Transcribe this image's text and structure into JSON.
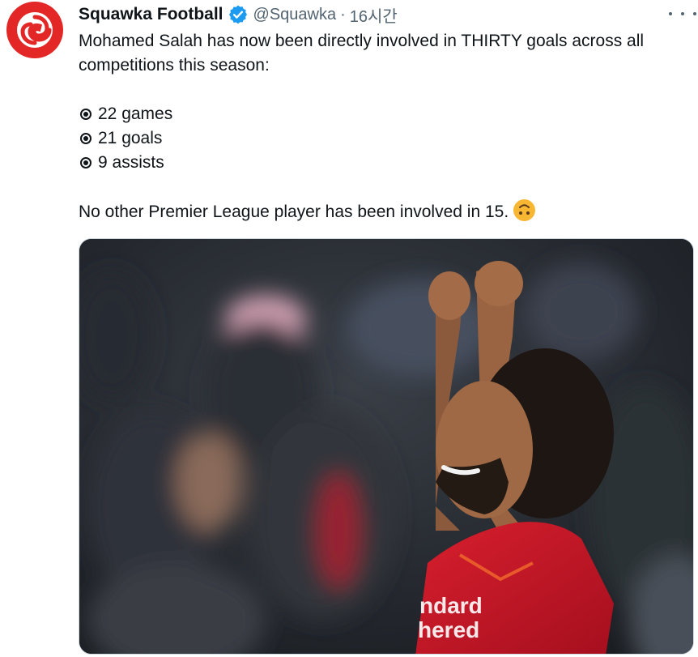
{
  "tweet": {
    "author": {
      "display_name": "Squawka Football",
      "handle": "@Squawka",
      "separator": "·",
      "time": "16시간",
      "verified": true,
      "avatar_color": "#e32726"
    },
    "text": {
      "intro_line1": "Mohamed Salah has now been directly involved in THIRTY goals across all",
      "intro_line2": "competitions this season:",
      "stats": [
        {
          "icon": "radio-bullet-icon",
          "label": "22 games"
        },
        {
          "icon": "radio-bullet-icon",
          "label": "21 goals"
        },
        {
          "icon": "radio-bullet-icon",
          "label": "9 assists"
        }
      ],
      "closing": "No other Premier League player has been involved in 15.",
      "emoji": "upside-down-face-icon"
    },
    "media": {
      "type": "photo",
      "kit_color": "#c8102e"
    }
  },
  "colors": {
    "text": "#0f1419",
    "secondary": "#536471",
    "verified": "#1d9bf0",
    "brand": "#e32726"
  }
}
